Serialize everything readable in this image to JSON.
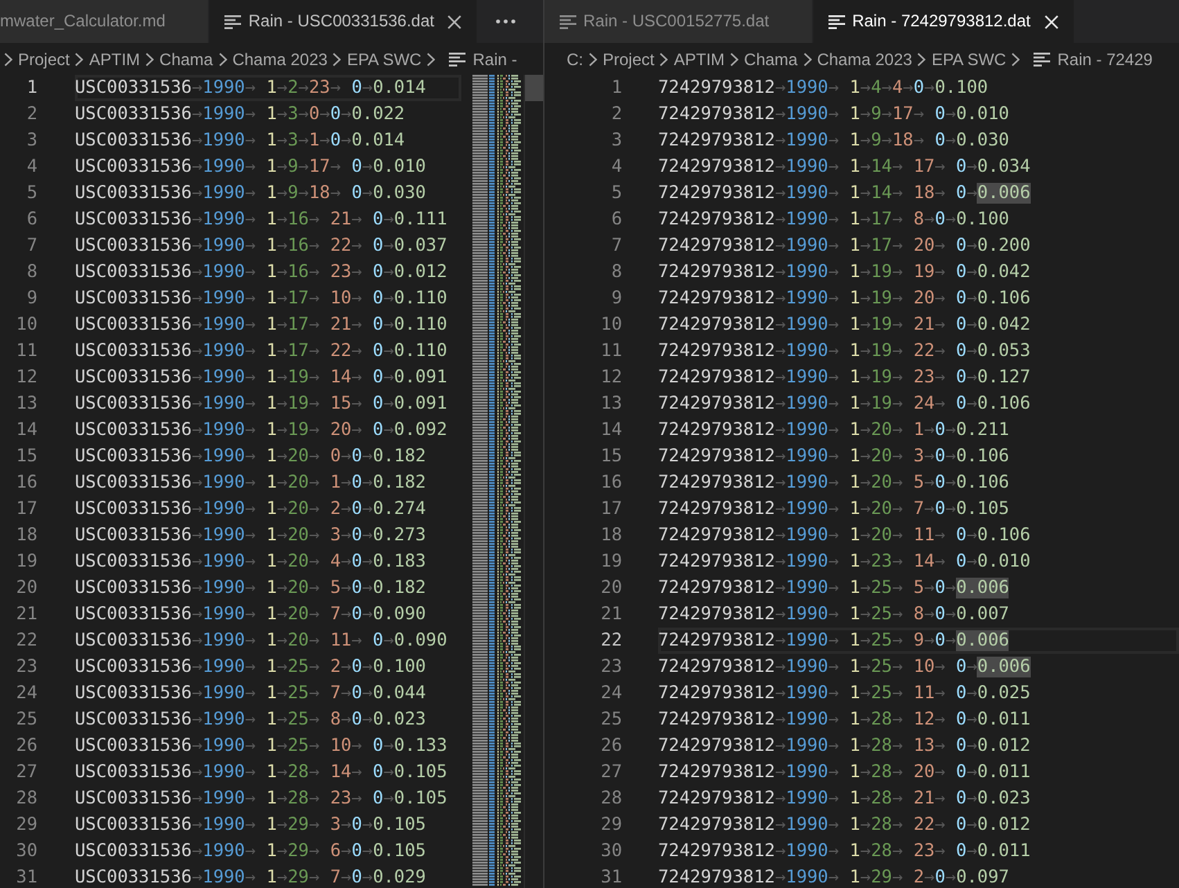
{
  "editor_groups": [
    {
      "focused": false,
      "more_actions": true,
      "minimap": true,
      "tabs": [
        {
          "label": "mwater_Calculator.md",
          "selected": false,
          "icon": false
        },
        {
          "label": "Rain - USC00331536.dat",
          "selected": true,
          "icon": true
        }
      ],
      "breadcrumbs": {
        "leading_chevron": true,
        "items": [
          {
            "label": "Project",
            "kind": "folder"
          },
          {
            "label": "APTIM",
            "kind": "folder"
          },
          {
            "label": "Chama",
            "kind": "folder"
          },
          {
            "label": "Chama 2023",
            "kind": "folder"
          },
          {
            "label": "EPA SWC",
            "kind": "folder"
          },
          {
            "label": "Rain -",
            "kind": "file"
          }
        ]
      },
      "lines": [
        {
          "number": "1",
          "current": true,
          "tokens": [
            "USC00331536",
            "→",
            "1990",
            "→ ",
            "1",
            "→",
            "2",
            "→",
            "23",
            "→ ",
            "0",
            "→",
            "0.014"
          ]
        },
        {
          "number": "2",
          "current": false,
          "tokens": [
            "USC00331536",
            "→",
            "1990",
            "→ ",
            "1",
            "→",
            "3",
            "→",
            "0",
            "→",
            "0",
            "→",
            "0.022"
          ]
        },
        {
          "number": "3",
          "current": false,
          "tokens": [
            "USC00331536",
            "→",
            "1990",
            "→ ",
            "1",
            "→",
            "3",
            "→",
            "1",
            "→",
            "0",
            "→",
            "0.014"
          ]
        },
        {
          "number": "4",
          "current": false,
          "tokens": [
            "USC00331536",
            "→",
            "1990",
            "→ ",
            "1",
            "→",
            "9",
            "→",
            "17",
            "→ ",
            "0",
            "→",
            "0.010"
          ]
        },
        {
          "number": "5",
          "current": false,
          "tokens": [
            "USC00331536",
            "→",
            "1990",
            "→ ",
            "1",
            "→",
            "9",
            "→",
            "18",
            "→ ",
            "0",
            "→",
            "0.030"
          ]
        },
        {
          "number": "6",
          "current": false,
          "tokens": [
            "USC00331536",
            "→",
            "1990",
            "→ ",
            "1",
            "→",
            "16",
            "→ ",
            "21",
            "→ ",
            "0",
            "→",
            "0.111"
          ]
        },
        {
          "number": "7",
          "current": false,
          "tokens": [
            "USC00331536",
            "→",
            "1990",
            "→ ",
            "1",
            "→",
            "16",
            "→ ",
            "22",
            "→ ",
            "0",
            "→",
            "0.037"
          ]
        },
        {
          "number": "8",
          "current": false,
          "tokens": [
            "USC00331536",
            "→",
            "1990",
            "→ ",
            "1",
            "→",
            "16",
            "→ ",
            "23",
            "→ ",
            "0",
            "→",
            "0.012"
          ]
        },
        {
          "number": "9",
          "current": false,
          "tokens": [
            "USC00331536",
            "→",
            "1990",
            "→ ",
            "1",
            "→",
            "17",
            "→ ",
            "10",
            "→ ",
            "0",
            "→",
            "0.110"
          ]
        },
        {
          "number": "10",
          "current": false,
          "tokens": [
            "USC00331536",
            "→",
            "1990",
            "→ ",
            "1",
            "→",
            "17",
            "→ ",
            "21",
            "→ ",
            "0",
            "→",
            "0.110"
          ]
        },
        {
          "number": "11",
          "current": false,
          "tokens": [
            "USC00331536",
            "→",
            "1990",
            "→ ",
            "1",
            "→",
            "17",
            "→ ",
            "22",
            "→ ",
            "0",
            "→",
            "0.110"
          ]
        },
        {
          "number": "12",
          "current": false,
          "tokens": [
            "USC00331536",
            "→",
            "1990",
            "→ ",
            "1",
            "→",
            "19",
            "→ ",
            "14",
            "→ ",
            "0",
            "→",
            "0.091"
          ]
        },
        {
          "number": "13",
          "current": false,
          "tokens": [
            "USC00331536",
            "→",
            "1990",
            "→ ",
            "1",
            "→",
            "19",
            "→ ",
            "15",
            "→ ",
            "0",
            "→",
            "0.091"
          ]
        },
        {
          "number": "14",
          "current": false,
          "tokens": [
            "USC00331536",
            "→",
            "1990",
            "→ ",
            "1",
            "→",
            "19",
            "→ ",
            "20",
            "→ ",
            "0",
            "→",
            "0.092"
          ]
        },
        {
          "number": "15",
          "current": false,
          "tokens": [
            "USC00331536",
            "→",
            "1990",
            "→ ",
            "1",
            "→",
            "20",
            "→ ",
            "0",
            "→",
            "0",
            "→",
            "0.182"
          ]
        },
        {
          "number": "16",
          "current": false,
          "tokens": [
            "USC00331536",
            "→",
            "1990",
            "→ ",
            "1",
            "→",
            "20",
            "→ ",
            "1",
            "→",
            "0",
            "→",
            "0.182"
          ]
        },
        {
          "number": "17",
          "current": false,
          "tokens": [
            "USC00331536",
            "→",
            "1990",
            "→ ",
            "1",
            "→",
            "20",
            "→ ",
            "2",
            "→",
            "0",
            "→",
            "0.274"
          ]
        },
        {
          "number": "18",
          "current": false,
          "tokens": [
            "USC00331536",
            "→",
            "1990",
            "→ ",
            "1",
            "→",
            "20",
            "→ ",
            "3",
            "→",
            "0",
            "→",
            "0.273"
          ]
        },
        {
          "number": "19",
          "current": false,
          "tokens": [
            "USC00331536",
            "→",
            "1990",
            "→ ",
            "1",
            "→",
            "20",
            "→ ",
            "4",
            "→",
            "0",
            "→",
            "0.183"
          ]
        },
        {
          "number": "20",
          "current": false,
          "tokens": [
            "USC00331536",
            "→",
            "1990",
            "→ ",
            "1",
            "→",
            "20",
            "→ ",
            "5",
            "→",
            "0",
            "→",
            "0.182"
          ]
        },
        {
          "number": "21",
          "current": false,
          "tokens": [
            "USC00331536",
            "→",
            "1990",
            "→ ",
            "1",
            "→",
            "20",
            "→ ",
            "7",
            "→",
            "0",
            "→",
            "0.090"
          ]
        },
        {
          "number": "22",
          "current": false,
          "tokens": [
            "USC00331536",
            "→",
            "1990",
            "→ ",
            "1",
            "→",
            "20",
            "→ ",
            "11",
            "→ ",
            "0",
            "→",
            "0.090"
          ]
        },
        {
          "number": "23",
          "current": false,
          "tokens": [
            "USC00331536",
            "→",
            "1990",
            "→ ",
            "1",
            "→",
            "25",
            "→ ",
            "2",
            "→",
            "0",
            "→",
            "0.100"
          ]
        },
        {
          "number": "24",
          "current": false,
          "tokens": [
            "USC00331536",
            "→",
            "1990",
            "→ ",
            "1",
            "→",
            "25",
            "→ ",
            "7",
            "→",
            "0",
            "→",
            "0.044"
          ]
        },
        {
          "number": "25",
          "current": false,
          "tokens": [
            "USC00331536",
            "→",
            "1990",
            "→ ",
            "1",
            "→",
            "25",
            "→ ",
            "8",
            "→",
            "0",
            "→",
            "0.023"
          ]
        },
        {
          "number": "26",
          "current": false,
          "tokens": [
            "USC00331536",
            "→",
            "1990",
            "→ ",
            "1",
            "→",
            "25",
            "→ ",
            "10",
            "→ ",
            "0",
            "→",
            "0.133"
          ]
        },
        {
          "number": "27",
          "current": false,
          "tokens": [
            "USC00331536",
            "→",
            "1990",
            "→ ",
            "1",
            "→",
            "28",
            "→ ",
            "14",
            "→ ",
            "0",
            "→",
            "0.105"
          ]
        },
        {
          "number": "28",
          "current": false,
          "tokens": [
            "USC00331536",
            "→",
            "1990",
            "→ ",
            "1",
            "→",
            "28",
            "→ ",
            "23",
            "→ ",
            "0",
            "→",
            "0.105"
          ]
        },
        {
          "number": "29",
          "current": false,
          "tokens": [
            "USC00331536",
            "→",
            "1990",
            "→ ",
            "1",
            "→",
            "29",
            "→ ",
            "3",
            "→",
            "0",
            "→",
            "0.105"
          ]
        },
        {
          "number": "30",
          "current": false,
          "tokens": [
            "USC00331536",
            "→",
            "1990",
            "→ ",
            "1",
            "→",
            "29",
            "→ ",
            "6",
            "→",
            "0",
            "→",
            "0.105"
          ]
        },
        {
          "number": "31",
          "current": false,
          "tokens": [
            "USC00331536",
            "→",
            "1990",
            "→ ",
            "1",
            "→",
            "29",
            "→ ",
            "7",
            "→",
            "0",
            "→",
            "0.029"
          ]
        }
      ]
    },
    {
      "focused": true,
      "tabs": [
        {
          "label": "Rain - USC00152775.dat",
          "selected": false,
          "icon": true
        },
        {
          "label": "Rain - 72429793812.dat",
          "selected": true,
          "icon": true
        }
      ],
      "breadcrumbs": {
        "leading_chevron": false,
        "items": [
          {
            "label": "C:",
            "kind": "folder"
          },
          {
            "label": "Project",
            "kind": "folder"
          },
          {
            "label": "APTIM",
            "kind": "folder"
          },
          {
            "label": "Chama",
            "kind": "folder"
          },
          {
            "label": "Chama 2023",
            "kind": "folder"
          },
          {
            "label": "EPA SWC",
            "kind": "folder"
          },
          {
            "label": "Rain - 72429",
            "kind": "file"
          }
        ]
      },
      "lines": [
        {
          "number": "1",
          "current": false,
          "highlighted": false,
          "tokens": [
            "72429793812",
            "→",
            "1990",
            "→ ",
            "1",
            "→",
            "4",
            "→",
            "4",
            "→",
            "0",
            "→",
            "0.100"
          ]
        },
        {
          "number": "2",
          "current": false,
          "highlighted": false,
          "tokens": [
            "72429793812",
            "→",
            "1990",
            "→ ",
            "1",
            "→",
            "9",
            "→",
            "17",
            "→ ",
            "0",
            "→",
            "0.010"
          ]
        },
        {
          "number": "3",
          "current": false,
          "highlighted": false,
          "tokens": [
            "72429793812",
            "→",
            "1990",
            "→ ",
            "1",
            "→",
            "9",
            "→",
            "18",
            "→ ",
            "0",
            "→",
            "0.030"
          ]
        },
        {
          "number": "4",
          "current": false,
          "highlighted": false,
          "tokens": [
            "72429793812",
            "→",
            "1990",
            "→ ",
            "1",
            "→",
            "14",
            "→ ",
            "17",
            "→ ",
            "0",
            "→",
            "0.034"
          ]
        },
        {
          "number": "5",
          "current": false,
          "highlighted": true,
          "tokens": [
            "72429793812",
            "→",
            "1990",
            "→ ",
            "1",
            "→",
            "14",
            "→ ",
            "18",
            "→ ",
            "0",
            "→",
            "0.006"
          ]
        },
        {
          "number": "6",
          "current": false,
          "highlighted": false,
          "tokens": [
            "72429793812",
            "→",
            "1990",
            "→ ",
            "1",
            "→",
            "17",
            "→ ",
            "8",
            "→",
            "0",
            "→",
            "0.100"
          ]
        },
        {
          "number": "7",
          "current": false,
          "highlighted": false,
          "tokens": [
            "72429793812",
            "→",
            "1990",
            "→ ",
            "1",
            "→",
            "17",
            "→ ",
            "20",
            "→ ",
            "0",
            "→",
            "0.200"
          ]
        },
        {
          "number": "8",
          "current": false,
          "highlighted": false,
          "tokens": [
            "72429793812",
            "→",
            "1990",
            "→ ",
            "1",
            "→",
            "19",
            "→ ",
            "19",
            "→ ",
            "0",
            "→",
            "0.042"
          ]
        },
        {
          "number": "9",
          "current": false,
          "highlighted": false,
          "tokens": [
            "72429793812",
            "→",
            "1990",
            "→ ",
            "1",
            "→",
            "19",
            "→ ",
            "20",
            "→ ",
            "0",
            "→",
            "0.106"
          ]
        },
        {
          "number": "10",
          "current": false,
          "highlighted": false,
          "tokens": [
            "72429793812",
            "→",
            "1990",
            "→ ",
            "1",
            "→",
            "19",
            "→ ",
            "21",
            "→ ",
            "0",
            "→",
            "0.042"
          ]
        },
        {
          "number": "11",
          "current": false,
          "highlighted": false,
          "tokens": [
            "72429793812",
            "→",
            "1990",
            "→ ",
            "1",
            "→",
            "19",
            "→ ",
            "22",
            "→ ",
            "0",
            "→",
            "0.053"
          ]
        },
        {
          "number": "12",
          "current": false,
          "highlighted": false,
          "tokens": [
            "72429793812",
            "→",
            "1990",
            "→ ",
            "1",
            "→",
            "19",
            "→ ",
            "23",
            "→ ",
            "0",
            "→",
            "0.127"
          ]
        },
        {
          "number": "13",
          "current": false,
          "highlighted": false,
          "tokens": [
            "72429793812",
            "→",
            "1990",
            "→ ",
            "1",
            "→",
            "19",
            "→ ",
            "24",
            "→ ",
            "0",
            "→",
            "0.106"
          ]
        },
        {
          "number": "14",
          "current": false,
          "highlighted": false,
          "tokens": [
            "72429793812",
            "→",
            "1990",
            "→ ",
            "1",
            "→",
            "20",
            "→ ",
            "1",
            "→",
            "0",
            "→",
            "0.211"
          ]
        },
        {
          "number": "15",
          "current": false,
          "highlighted": false,
          "tokens": [
            "72429793812",
            "→",
            "1990",
            "→ ",
            "1",
            "→",
            "20",
            "→ ",
            "3",
            "→",
            "0",
            "→",
            "0.106"
          ]
        },
        {
          "number": "16",
          "current": false,
          "highlighted": false,
          "tokens": [
            "72429793812",
            "→",
            "1990",
            "→ ",
            "1",
            "→",
            "20",
            "→ ",
            "5",
            "→",
            "0",
            "→",
            "0.106"
          ]
        },
        {
          "number": "17",
          "current": false,
          "highlighted": false,
          "tokens": [
            "72429793812",
            "→",
            "1990",
            "→ ",
            "1",
            "→",
            "20",
            "→ ",
            "7",
            "→",
            "0",
            "→",
            "0.105"
          ]
        },
        {
          "number": "18",
          "current": false,
          "highlighted": false,
          "tokens": [
            "72429793812",
            "→",
            "1990",
            "→ ",
            "1",
            "→",
            "20",
            "→ ",
            "11",
            "→ ",
            "0",
            "→",
            "0.106"
          ]
        },
        {
          "number": "19",
          "current": false,
          "highlighted": false,
          "tokens": [
            "72429793812",
            "→",
            "1990",
            "→ ",
            "1",
            "→",
            "23",
            "→ ",
            "14",
            "→ ",
            "0",
            "→",
            "0.010"
          ]
        },
        {
          "number": "20",
          "current": false,
          "highlighted": true,
          "tokens": [
            "72429793812",
            "→",
            "1990",
            "→ ",
            "1",
            "→",
            "25",
            "→ ",
            "5",
            "→",
            "0",
            "→",
            "0.006"
          ]
        },
        {
          "number": "21",
          "current": false,
          "highlighted": false,
          "tokens": [
            "72429793812",
            "→",
            "1990",
            "→ ",
            "1",
            "→",
            "25",
            "→ ",
            "8",
            "→",
            "0",
            "→",
            "0.007"
          ]
        },
        {
          "number": "22",
          "current": true,
          "highlighted": true,
          "tokens": [
            "72429793812",
            "→",
            "1990",
            "→ ",
            "1",
            "→",
            "25",
            "→ ",
            "9",
            "→",
            "0",
            "→",
            "0.006"
          ]
        },
        {
          "number": "23",
          "current": false,
          "highlighted": true,
          "tokens": [
            "72429793812",
            "→",
            "1990",
            "→ ",
            "1",
            "→",
            "25",
            "→ ",
            "10",
            "→ ",
            "0",
            "→",
            "0.006"
          ]
        },
        {
          "number": "24",
          "current": false,
          "highlighted": false,
          "tokens": [
            "72429793812",
            "→",
            "1990",
            "→ ",
            "1",
            "→",
            "25",
            "→ ",
            "11",
            "→ ",
            "0",
            "→",
            "0.025"
          ]
        },
        {
          "number": "25",
          "current": false,
          "highlighted": false,
          "tokens": [
            "72429793812",
            "→",
            "1990",
            "→ ",
            "1",
            "→",
            "28",
            "→ ",
            "12",
            "→ ",
            "0",
            "→",
            "0.011"
          ]
        },
        {
          "number": "26",
          "current": false,
          "highlighted": false,
          "tokens": [
            "72429793812",
            "→",
            "1990",
            "→ ",
            "1",
            "→",
            "28",
            "→ ",
            "13",
            "→ ",
            "0",
            "→",
            "0.012"
          ]
        },
        {
          "number": "27",
          "current": false,
          "highlighted": false,
          "tokens": [
            "72429793812",
            "→",
            "1990",
            "→ ",
            "1",
            "→",
            "28",
            "→ ",
            "20",
            "→ ",
            "0",
            "→",
            "0.011"
          ]
        },
        {
          "number": "28",
          "current": false,
          "highlighted": false,
          "tokens": [
            "72429793812",
            "→",
            "1990",
            "→ ",
            "1",
            "→",
            "28",
            "→ ",
            "21",
            "→ ",
            "0",
            "→",
            "0.023"
          ]
        },
        {
          "number": "29",
          "current": false,
          "highlighted": false,
          "tokens": [
            "72429793812",
            "→",
            "1990",
            "→ ",
            "1",
            "→",
            "28",
            "→ ",
            "22",
            "→ ",
            "0",
            "→",
            "0.012"
          ]
        },
        {
          "number": "30",
          "current": false,
          "highlighted": false,
          "tokens": [
            "72429793812",
            "→",
            "1990",
            "→ ",
            "1",
            "→",
            "28",
            "→ ",
            "23",
            "→ ",
            "0",
            "→",
            "0.011"
          ]
        },
        {
          "number": "31",
          "current": false,
          "highlighted": false,
          "tokens": [
            "72429793812",
            "→",
            "1990",
            "→ ",
            "1",
            "→",
            "29",
            "→ ",
            "2",
            "→",
            "0",
            "→",
            "0.097"
          ]
        }
      ]
    }
  ]
}
